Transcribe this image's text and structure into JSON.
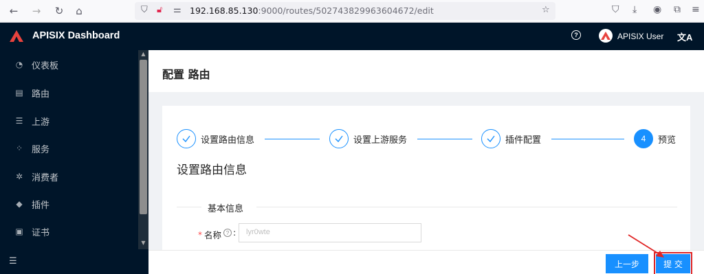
{
  "browser": {
    "url_host": "192.168.85.130",
    "url_rest": ":9000/routes/502743829963604672/edit"
  },
  "header": {
    "app_title": "APISIX Dashboard",
    "help_glyph": "?",
    "user_name": "APISIX User",
    "lang_glyph": "文A"
  },
  "sidebar": {
    "items": [
      {
        "label": "仪表板",
        "icon": "dashboard-icon",
        "glyph": "◔"
      },
      {
        "label": "路由",
        "icon": "route-icon",
        "glyph": "▤"
      },
      {
        "label": "上游",
        "icon": "upstream-icon",
        "glyph": "☰"
      },
      {
        "label": "服务",
        "icon": "service-icon",
        "glyph": "⁘"
      },
      {
        "label": "消费者",
        "icon": "consumer-icon",
        "glyph": "✲"
      },
      {
        "label": "插件",
        "icon": "plugin-icon",
        "glyph": "◆"
      },
      {
        "label": "证书",
        "icon": "certificate-icon",
        "glyph": "▣"
      }
    ],
    "collapse_glyph": "☰"
  },
  "page": {
    "title": "配置 路由"
  },
  "steps": [
    {
      "title": "设置路由信息",
      "status": "finished"
    },
    {
      "title": "设置上游服务",
      "status": "finished"
    },
    {
      "title": "插件配置",
      "status": "finished"
    },
    {
      "number": "4",
      "title": "预览",
      "status": "active"
    }
  ],
  "form": {
    "section_title": "设置路由信息",
    "group_title": "基本信息",
    "name_label": "名称",
    "name_value": "lyr0wte"
  },
  "footer": {
    "prev_label": "上一步",
    "submit_label": "提 交"
  },
  "colors": {
    "primary": "#1890ff",
    "sidebar_bg": "#001529",
    "highlight": "#e02424"
  }
}
